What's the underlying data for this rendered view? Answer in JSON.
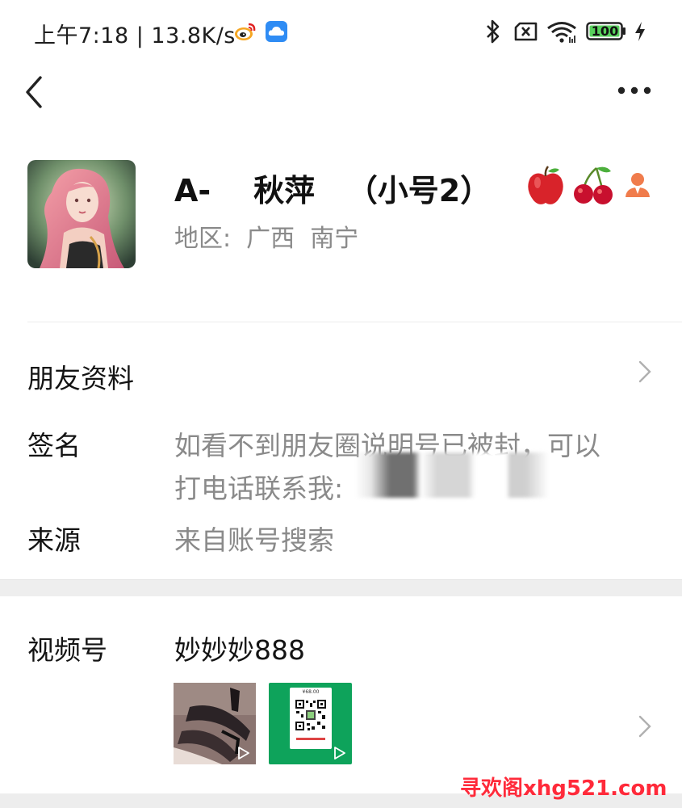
{
  "status_bar": {
    "time_speed": "上午7:18 | 13.8K/s",
    "battery_level": "100",
    "icons": [
      "weibo-icon",
      "cloud-icon",
      "bluetooth-icon",
      "no-sim-icon",
      "wifi-icon",
      "battery-icon",
      "charging-icon"
    ]
  },
  "nav": {
    "back_icon": "back-icon",
    "more_icon": "more-icon"
  },
  "profile": {
    "name": "A-    秋萍   （小号2）",
    "region": "地区:  广西  南宁",
    "emoji": [
      "apple-icon",
      "cherry-icon"
    ],
    "badge_icon": "person-icon"
  },
  "rows": {
    "friend_info_label": "朋友资料",
    "signature_label": "签名",
    "signature_line1": "如看不到朋友圈说明号已被封，可以",
    "signature_line2": "打电话联系我:",
    "source_label": "来源",
    "source_value": "来自账号搜索",
    "channels_label": "视频号",
    "channels_value": "妙妙妙888"
  },
  "thumbnails": {
    "qr_price": "¥68.00",
    "play_icon": "play-icon"
  },
  "watermark": "寻欢阁xhg521.com",
  "colors": {
    "accent_green": "#0ea35b",
    "watermark_red": "#ff2a3a",
    "text_gray": "#8a8a8a"
  }
}
